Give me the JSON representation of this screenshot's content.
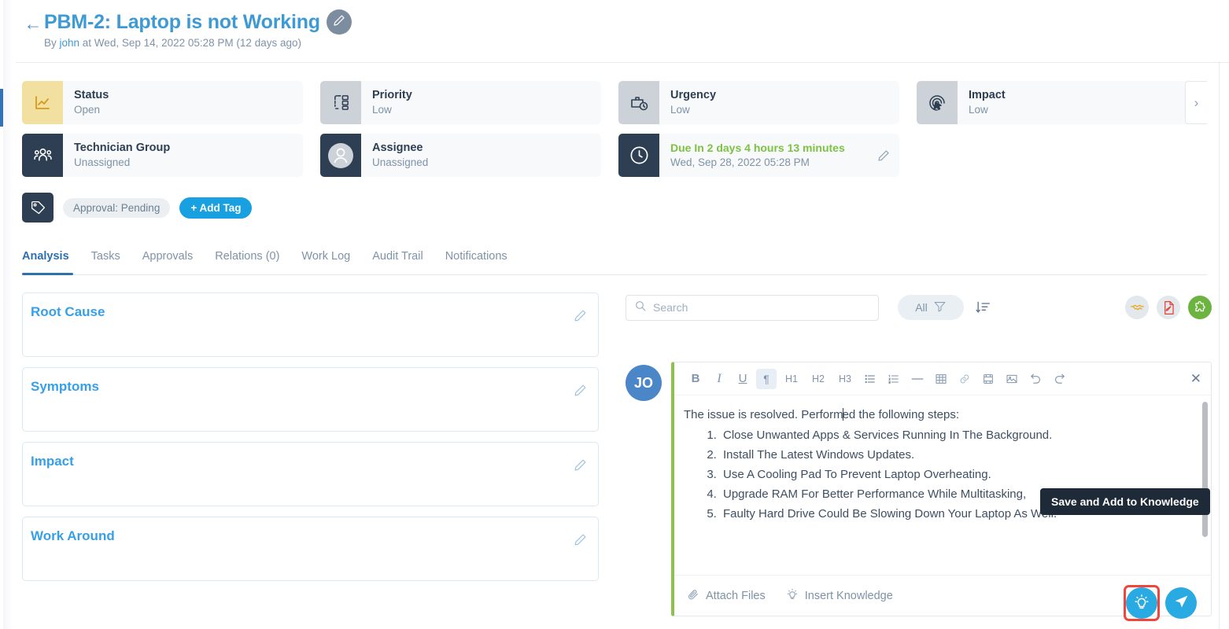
{
  "header": {
    "back_icon": "arrow-left-icon",
    "title": "PBM-2: Laptop is not Working",
    "edit_icon": "pencil-icon",
    "meta_prefix": "By ",
    "meta_user": "john",
    "meta_suffix": " at Wed, Sep 14, 2022 05:28 PM (12 days ago)"
  },
  "cards": [
    {
      "label": "Status",
      "value": "Open",
      "icon": "chart-line-icon",
      "icon_style": "yellow"
    },
    {
      "label": "Priority",
      "value": "Low",
      "icon": "priority-flow-icon",
      "icon_style": "gray"
    },
    {
      "label": "Urgency",
      "value": "Low",
      "icon": "briefcase-clock-icon",
      "icon_style": "gray"
    },
    {
      "label": "Impact",
      "value": "Low",
      "icon": "fingerprint-cursor-icon",
      "icon_style": "gray"
    }
  ],
  "cards_row2": [
    {
      "label": "Technician Group",
      "value": "Unassigned",
      "icon": "users-group-icon",
      "icon_style": "dark"
    },
    {
      "label": "Assignee",
      "value": "Unassigned",
      "icon": "user-avatar-icon",
      "icon_style": "dark"
    }
  ],
  "due": {
    "icon": "clock-icon",
    "headline": "Due In 2 days 4 hours 13 minutes",
    "date": "Wed, Sep 28, 2022 05:28 PM",
    "edit_icon": "pencil-icon",
    "color": "#7dc242"
  },
  "carousel_next_icon": "chevron-right-icon",
  "tags": {
    "icon": "tag-icon",
    "pills": [
      "Approval: Pending"
    ],
    "add_label": "+ Add Tag"
  },
  "tabs": [
    {
      "label": "Analysis",
      "active": true
    },
    {
      "label": "Tasks",
      "active": false
    },
    {
      "label": "Approvals",
      "active": false
    },
    {
      "label": "Relations (0)",
      "active": false
    },
    {
      "label": "Work Log",
      "active": false
    },
    {
      "label": "Audit Trail",
      "active": false
    },
    {
      "label": "Notifications",
      "active": false
    }
  ],
  "analysis_sections": [
    {
      "title": "Root Cause",
      "body": "",
      "edit_icon": "pencil-icon"
    },
    {
      "title": "Symptoms",
      "body": "",
      "edit_icon": "pencil-icon"
    },
    {
      "title": "Impact",
      "body": "",
      "edit_icon": "pencil-icon"
    },
    {
      "title": "Work Around",
      "body": "",
      "edit_icon": "pencil-icon"
    }
  ],
  "conversation_toolbar": {
    "search_placeholder": "Search",
    "search_value": "",
    "search_icon": "search-icon",
    "filter_label": "All",
    "filter_icon": "funnel-icon",
    "sort_icon": "sort-descending-icon",
    "actions": [
      {
        "name": "handshake-icon",
        "style": "gray"
      },
      {
        "name": "document-edit-icon",
        "style": "gray"
      },
      {
        "name": "puzzle-piece-icon",
        "style": "green"
      }
    ]
  },
  "editor": {
    "avatar_initials": "JO",
    "accent_color": "#8bc34a",
    "toolbar": [
      {
        "name": "bold-icon",
        "label": "B",
        "active": false
      },
      {
        "name": "italic-icon",
        "label": "I",
        "active": false
      },
      {
        "name": "underline-icon",
        "label": "U",
        "active": false
      },
      {
        "name": "paragraph-icon",
        "label": "¶",
        "active": true
      },
      {
        "name": "heading-1-icon",
        "label": "H1",
        "active": false
      },
      {
        "name": "heading-2-icon",
        "label": "H2",
        "active": false
      },
      {
        "name": "heading-3-icon",
        "label": "H3",
        "active": false
      },
      {
        "name": "bullet-list-icon",
        "label": "",
        "active": false
      },
      {
        "name": "numbered-list-icon",
        "label": "",
        "active": false
      },
      {
        "name": "horizontal-rule-icon",
        "label": "",
        "active": false
      },
      {
        "name": "table-icon",
        "label": "",
        "active": false
      },
      {
        "name": "link-icon",
        "label": "",
        "active": false
      },
      {
        "name": "video-icon",
        "label": "",
        "active": false
      },
      {
        "name": "image-icon",
        "label": "",
        "active": false
      },
      {
        "name": "undo-icon",
        "label": "",
        "active": false
      },
      {
        "name": "redo-icon",
        "label": "",
        "active": false
      }
    ],
    "close_icon": "close-icon",
    "intro_before_caret": "The issue is resolved. Perform",
    "intro_after_caret": "ed the following steps:",
    "steps": [
      "Close Unwanted Apps & Services Running In The Background.",
      "Install The Latest Windows Updates.",
      "Use A Cooling Pad To Prevent Laptop Overheating.",
      "Upgrade RAM For Better Performance While Multitasking,",
      "Faulty Hard Drive Could Be Slowing Down Your Laptop As Well."
    ],
    "save_knowledge_icon": "lightbulb-icon",
    "send_icon": "send-paper-plane-icon",
    "footer": [
      {
        "icon": "paperclip-icon",
        "label": "Attach Files"
      },
      {
        "icon": "lightbulb-icon",
        "label": "Insert Knowledge"
      }
    ]
  },
  "tooltip": {
    "text": "Save and Add to Knowledge"
  }
}
